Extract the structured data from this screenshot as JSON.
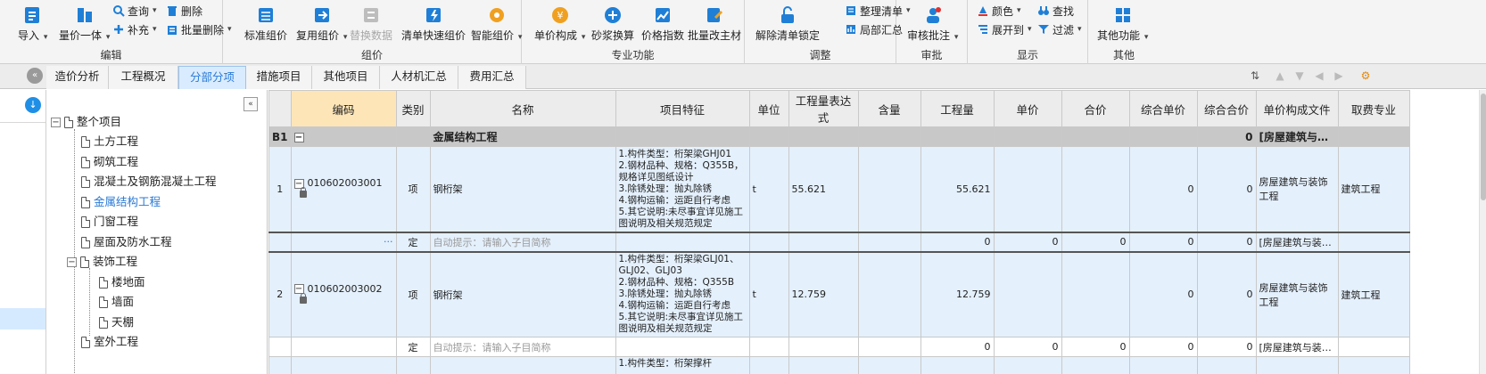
{
  "ribbon": {
    "groups": {
      "edit": "编辑",
      "price": "组价",
      "pro": "专业功能",
      "adjust": "调整",
      "review": "审批",
      "display": "显示",
      "other": "其他"
    },
    "buttons": {
      "import": "导入",
      "quantity_price": "量价一体",
      "query": "查询",
      "supplement": "补充",
      "delete": "删除",
      "batch_delete": "批量删除",
      "standard_price": "标准组价",
      "reuse_price": "复用组价",
      "replace_data": "替换数据",
      "quick_price": "清单快速组价",
      "smart_price": "智能组价",
      "unit_compose": "单价构成",
      "mortar_convert": "砂浆换算",
      "price_index": "价格指数",
      "batch_main_material": "批量改主材",
      "unlock_list": "解除清单锁定",
      "organize_list": "整理清单",
      "partial_summary": "局部汇总",
      "review_annotate": "审核批注",
      "color": "颜色",
      "expand_to": "展开到",
      "find": "查找",
      "filter": "过滤",
      "other_functions": "其他功能"
    }
  },
  "tabs": [
    "造价分析",
    "工程概况",
    "分部分项",
    "措施项目",
    "其他项目",
    "人材机汇总",
    "费用汇总"
  ],
  "active_tab": "分部分项",
  "tree": {
    "root": "整个项目",
    "items": [
      "土方工程",
      "砌筑工程",
      "混凝土及钢筋混凝土工程",
      "金属结构工程",
      "门窗工程",
      "屋面及防水工程",
      "装饰工程",
      "楼地面",
      "墙面",
      "天棚",
      "室外工程"
    ],
    "selected": "金属结构工程"
  },
  "grid": {
    "headers": [
      "编码",
      "类别",
      "名称",
      "项目特征",
      "单位",
      "工程量表达式",
      "含量",
      "工程量",
      "单价",
      "合价",
      "综合单价",
      "综合合价",
      "单价构成文件",
      "取费专业"
    ],
    "section": {
      "no": "B1",
      "name": "金属结构工程",
      "total": "0",
      "file": "[房屋建筑与…"
    },
    "rows": [
      {
        "no": "1",
        "code": "010602003001",
        "type": "项",
        "name": "钢桁架",
        "feature": "1.构件类型：桁架梁GHJ01\n2.钢材品种、规格：Q355B，规格详见图纸设计\n3.除锈处理：抛丸除锈\n4.钢构运输：运距自行考虑\n5.其它说明:未尽事宜详见施工图说明及相关规范规定",
        "unit": "t",
        "expr": "55.621",
        "qty": "55.621",
        "comp_price": "0",
        "comp_total": "0",
        "file": "房屋建筑与装饰工程",
        "specialty": "建筑工程"
      },
      {
        "no": "2",
        "code": "010602003002",
        "type": "项",
        "name": "钢桁架",
        "feature": "1.构件类型：桁架梁GLJ01、GLJ02、GLJ03\n2.钢材品种、规格：Q355B\n3.除锈处理：抛丸除锈\n4.钢构运输：运距自行考虑\n5.其它说明:未尽事宜详见施工图说明及相关规范规定",
        "unit": "t",
        "expr": "12.759",
        "qty": "12.759",
        "comp_price": "0",
        "comp_total": "0",
        "file": "房屋建筑与装饰工程",
        "specialty": "建筑工程"
      }
    ],
    "sub_row": {
      "type": "定",
      "hint": "自动提示：请输入子目简称",
      "qty": "0",
      "price": "0",
      "total": "0",
      "comp_price": "0",
      "comp_total": "0",
      "file": "[房屋建筑与装…",
      "dots": "···"
    },
    "partial_feature": "1.构件类型：桁架撑杆"
  }
}
